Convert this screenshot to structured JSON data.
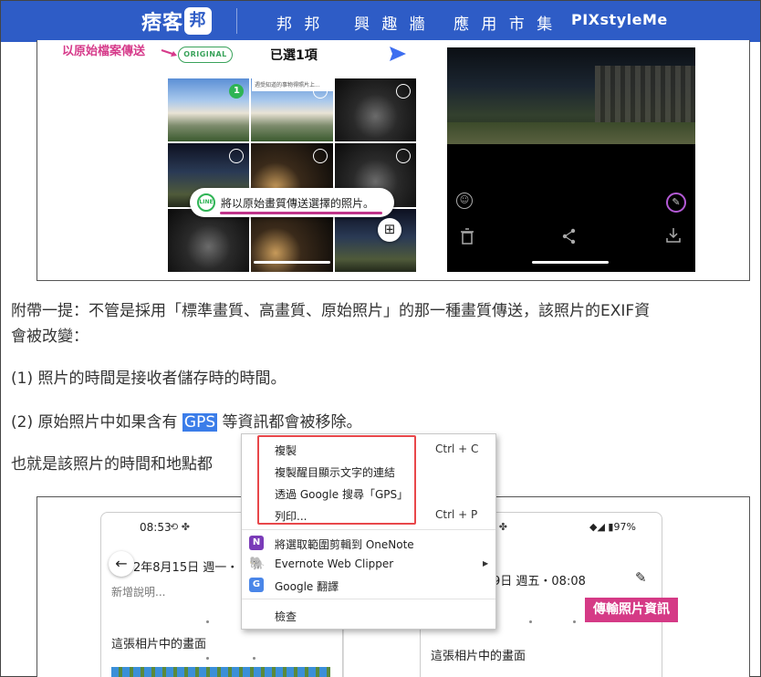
{
  "header": {
    "logo_text": "痞客",
    "logo_badge": "邦",
    "nav": [
      "邦 邦",
      "興 趣 牆",
      "應 用 市 集",
      "PIXstyleMe"
    ]
  },
  "figure1": {
    "annotation": "以原始檔案傳送",
    "original_badge": "ORIGINAL",
    "selected_count": "已選1項",
    "selected_index": "1",
    "text_strip": "週受知道的事物得照片上...",
    "toast_icon_text": "LINE",
    "toast_text": "將以原始畫質傳送選擇的照片。",
    "grid_button": "⊞"
  },
  "body": {
    "p1a": "附帶一提：不管是採用「標準畫質、高畫質、原始照片」的那一種畫質傳送，該照片的EXIF資",
    "p1b": "會被改變：",
    "p2": "(1) 照片的時間是接收者儲存時的時間。",
    "p3_before": "(2) 原始照片中如果含有 ",
    "p3_highlight": "GPS",
    "p3_after": " 等資訊都會被移除。",
    "p4": "也就是該照片的時間和地點都"
  },
  "figure2": {
    "left_time": "08:53",
    "left_status_icons": "⟲ ✤",
    "left_back": "←",
    "left_date": "2年8月15日 週一・",
    "left_desc": "新增說明...",
    "left_label": "這張相片中的畫面",
    "right_status_icons": "⟲ ✤",
    "right_battery": "◆◢ ▮97%",
    "right_date": "9日 週五・08:08",
    "right_edit": "✎",
    "right_label": "這張相片中的畫面",
    "tag": "傳輸照片資訊"
  },
  "context_menu": {
    "items": [
      {
        "label": "複製",
        "shortcut": "Ctrl + C"
      },
      {
        "label": "複製醒目顯示文字的連結",
        "shortcut": ""
      },
      {
        "label": "透過 Google 搜尋「GPS」",
        "shortcut": ""
      },
      {
        "label": "列印...",
        "shortcut": "Ctrl + P"
      },
      {
        "label": "將選取範圍剪輯到 OneNote",
        "icon": "onenote-icon",
        "icon_text": "N"
      },
      {
        "label": "Evernote Web Clipper",
        "icon": "evernote-icon",
        "icon_text": "🐘",
        "submenu": "▶"
      },
      {
        "label": "Google 翻譯",
        "icon": "google-translate-icon",
        "icon_text": "G"
      },
      {
        "label": "檢查",
        "shortcut": ""
      }
    ]
  },
  "colors": {
    "header_bg": "#2e5cc6",
    "annotation_pink": "#d63a8a",
    "highlight_red": "#e8474a",
    "selection_blue": "#3b7de9",
    "tag_pink": "#d53a86",
    "line_green": "#2fb455"
  }
}
